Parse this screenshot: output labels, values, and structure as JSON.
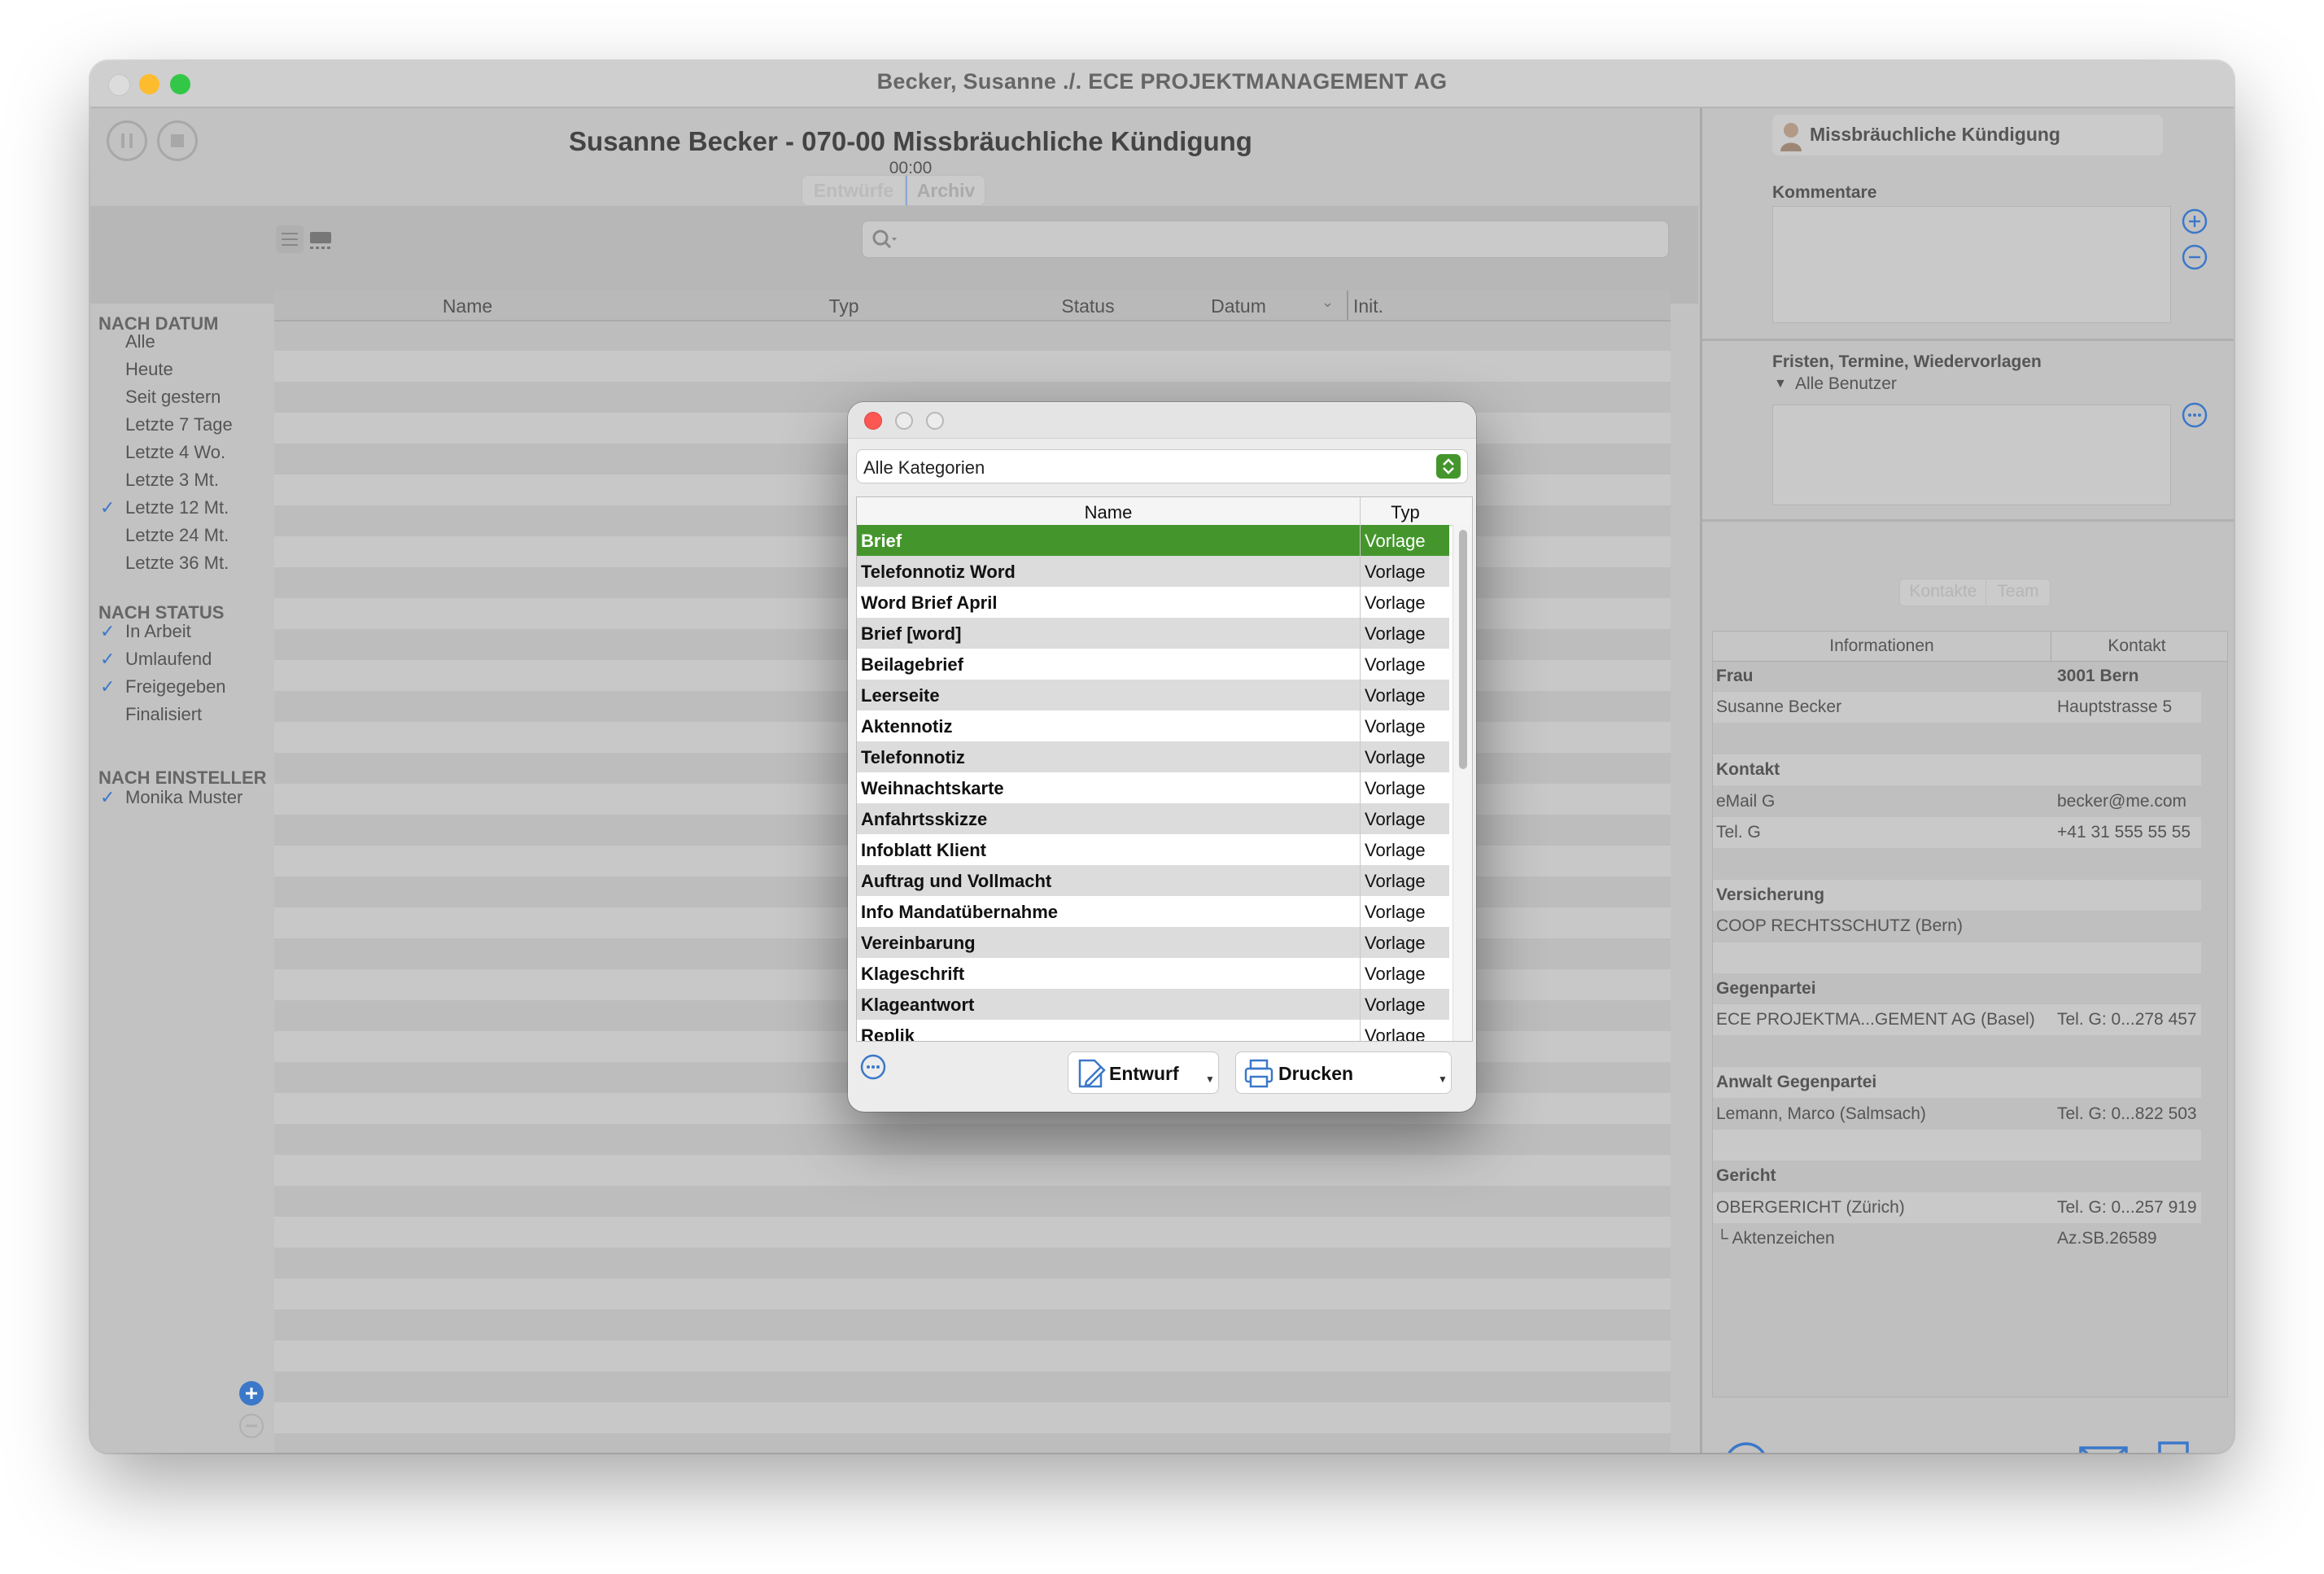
{
  "window": {
    "title": "Becker, Susanne ./. ECE PROJEKTMANAGEMENT AG"
  },
  "document": {
    "title": "Susanne Becker - 070-00 Missbräuchliche Kündigung",
    "timer": "00:00",
    "segments": [
      "Entwürfe",
      "Archiv"
    ]
  },
  "table": {
    "columns": [
      "Name",
      "Typ",
      "Status",
      "Datum",
      "Init."
    ]
  },
  "sidebar": {
    "date_header": "NACH DATUM",
    "date_items": [
      {
        "label": "Alle",
        "checked": false
      },
      {
        "label": "Heute",
        "checked": false
      },
      {
        "label": "Seit gestern",
        "checked": false
      },
      {
        "label": "Letzte 7 Tage",
        "checked": false
      },
      {
        "label": "Letzte 4 Wo.",
        "checked": false
      },
      {
        "label": "Letzte 3 Mt.",
        "checked": false
      },
      {
        "label": "Letzte 12 Mt.",
        "checked": true
      },
      {
        "label": "Letzte 24 Mt.",
        "checked": false
      },
      {
        "label": "Letzte 36 Mt.",
        "checked": false
      }
    ],
    "status_header": "NACH STATUS",
    "status_items": [
      {
        "label": "In Arbeit",
        "checked": true
      },
      {
        "label": "Umlaufend",
        "checked": true
      },
      {
        "label": "Freigegeben",
        "checked": true
      },
      {
        "label": "Finalisiert",
        "checked": false
      }
    ],
    "creator_header": "NACH EINSTELLER",
    "creator_items": [
      {
        "label": "Monika Muster",
        "checked": true
      }
    ]
  },
  "right_panel": {
    "case_button": "Missbräuchliche Kündigung",
    "comments_label": "Kommentare",
    "deadlines_label": "Fristen, Termine, Wiedervorlagen",
    "users_filter": "Alle Benutzer",
    "tabs": [
      "Kontakte",
      "Team"
    ],
    "info_columns": [
      "Informationen",
      "Kontakt"
    ],
    "info_rows": [
      {
        "left": "Frau",
        "right": "3001 Bern",
        "bold": true
      },
      {
        "left": "Susanne Becker",
        "right": "Hauptstrasse 5",
        "bold": false
      },
      {
        "left": "",
        "right": "",
        "bold": false
      },
      {
        "left": "Kontakt",
        "right": "",
        "bold": true
      },
      {
        "left": "eMail G",
        "right": "becker@me.com",
        "bold": false
      },
      {
        "left": "Tel. G",
        "right": "+41 31 555 55 55",
        "bold": false
      },
      {
        "left": "",
        "right": "",
        "bold": false
      },
      {
        "left": "Versicherung",
        "right": "",
        "bold": true
      },
      {
        "left": "COOP RECHTSSCHUTZ (Bern)",
        "right": "",
        "bold": false
      },
      {
        "left": "",
        "right": "",
        "bold": false
      },
      {
        "left": "Gegenpartei",
        "right": "",
        "bold": true
      },
      {
        "left": "ECE PROJEKTMA...GEMENT AG (Basel)",
        "right": "Tel. G: 0...278 457",
        "bold": false
      },
      {
        "left": "",
        "right": "",
        "bold": false
      },
      {
        "left": "Anwalt Gegenpartei",
        "right": "",
        "bold": true
      },
      {
        "left": "Lemann, Marco (Salmsach)",
        "right": "Tel. G: 0...822 503",
        "bold": false
      },
      {
        "left": "",
        "right": "",
        "bold": false
      },
      {
        "left": "Gericht",
        "right": "",
        "bold": true
      },
      {
        "left": "OBERGERICHT (Zürich)",
        "right": "Tel. G: 0...257 919",
        "bold": false
      },
      {
        "left": "└ Aktenzeichen",
        "right": "Az.SB.26589",
        "bold": false
      }
    ]
  },
  "dialog": {
    "category": "Alle Kategorien",
    "columns": [
      "Name",
      "Typ"
    ],
    "rows": [
      {
        "name": "Brief",
        "type": "Vorlage"
      },
      {
        "name": "Telefonnotiz Word",
        "type": "Vorlage"
      },
      {
        "name": "Word Brief April",
        "type": "Vorlage"
      },
      {
        "name": "Brief [word]",
        "type": "Vorlage"
      },
      {
        "name": "Beilagebrief",
        "type": "Vorlage"
      },
      {
        "name": "Leerseite",
        "type": "Vorlage"
      },
      {
        "name": "Aktennotiz",
        "type": "Vorlage"
      },
      {
        "name": "Telefonnotiz",
        "type": "Vorlage"
      },
      {
        "name": "Weihnachtskarte",
        "type": "Vorlage"
      },
      {
        "name": "Anfahrtsskizze",
        "type": "Vorlage"
      },
      {
        "name": "Infoblatt Klient",
        "type": "Vorlage"
      },
      {
        "name": "Auftrag und Vollmacht",
        "type": "Vorlage"
      },
      {
        "name": "Info Mandatübernahme",
        "type": "Vorlage"
      },
      {
        "name": "Vereinbarung",
        "type": "Vorlage"
      },
      {
        "name": "Klageschrift",
        "type": "Vorlage"
      },
      {
        "name": "Klageantwort",
        "type": "Vorlage"
      },
      {
        "name": "Replik",
        "type": "Vorlage"
      }
    ],
    "selected_index": 0,
    "draft_button": "Entwurf",
    "print_button": "Drucken"
  },
  "colors": {
    "selection": "#44962c",
    "accent": "#3b78c9",
    "close": "#fc5753",
    "minimize": "#fdbc2e",
    "zoom": "#33c748"
  },
  "icons": [
    "pause-icon",
    "stop-icon",
    "list-view-icon",
    "gallery-view-icon",
    "search-icon",
    "person-icon",
    "plus-icon",
    "minus-icon",
    "more-icon",
    "mail-icon",
    "printer-icon",
    "draft-icon",
    "chevron-updown-icon"
  ]
}
